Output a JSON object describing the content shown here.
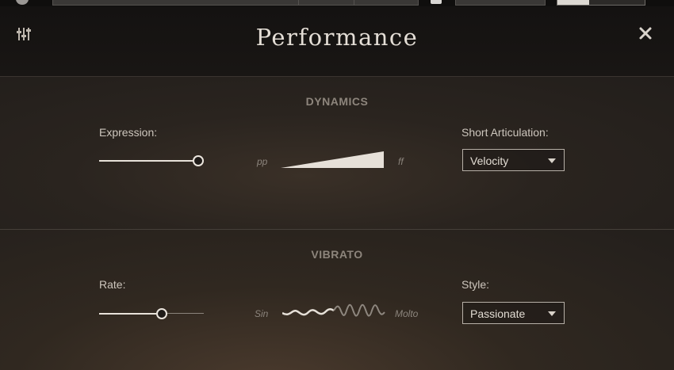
{
  "header": {
    "title": "Performance"
  },
  "icons": {
    "mixer": "sliders-icon",
    "close": "close-icon"
  },
  "dynamics": {
    "section_title": "DYNAMICS",
    "expression_label": "Expression:",
    "expression_value": 1.0,
    "range_low": "pp",
    "range_high": "ff",
    "short_articulation_label": "Short Articulation:",
    "short_articulation_value": "Velocity"
  },
  "vibrato": {
    "section_title": "VIBRATO",
    "rate_label": "Rate:",
    "rate_value": 0.61,
    "range_low": "Sin",
    "range_high": "Molto",
    "style_label": "Style:",
    "style_value": "Passionate"
  },
  "colors": {
    "background": "#1f1b18",
    "header": "#141211",
    "text": "#cdc6bd",
    "accent": "#e8e2da"
  }
}
